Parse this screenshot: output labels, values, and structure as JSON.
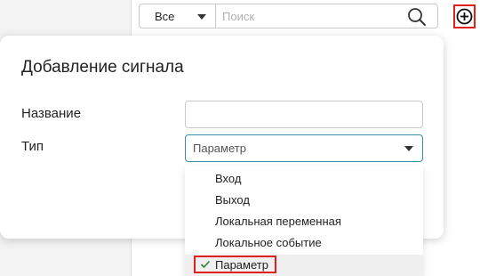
{
  "toolbar": {
    "filter": {
      "selected": "Все"
    },
    "search": {
      "placeholder": "Поиск",
      "value": ""
    }
  },
  "dialog": {
    "title": "Добавление сигнала",
    "fields": {
      "name": {
        "label": "Название",
        "value": ""
      },
      "type": {
        "label": "Тип",
        "value": "Параметр"
      }
    },
    "type_options": [
      {
        "label": "Вход"
      },
      {
        "label": "Выход"
      },
      {
        "label": "Локальная переменная"
      },
      {
        "label": "Локальное событие"
      },
      {
        "label": "Параметр",
        "selected": true
      }
    ]
  },
  "colors": {
    "highlight_red": "#e0201c",
    "focus_teal": "#3a8fa6",
    "check_green": "#2e7d32"
  },
  "icons": [
    "chevron-down-icon",
    "search-icon",
    "plus-circle-icon",
    "check-icon"
  ]
}
